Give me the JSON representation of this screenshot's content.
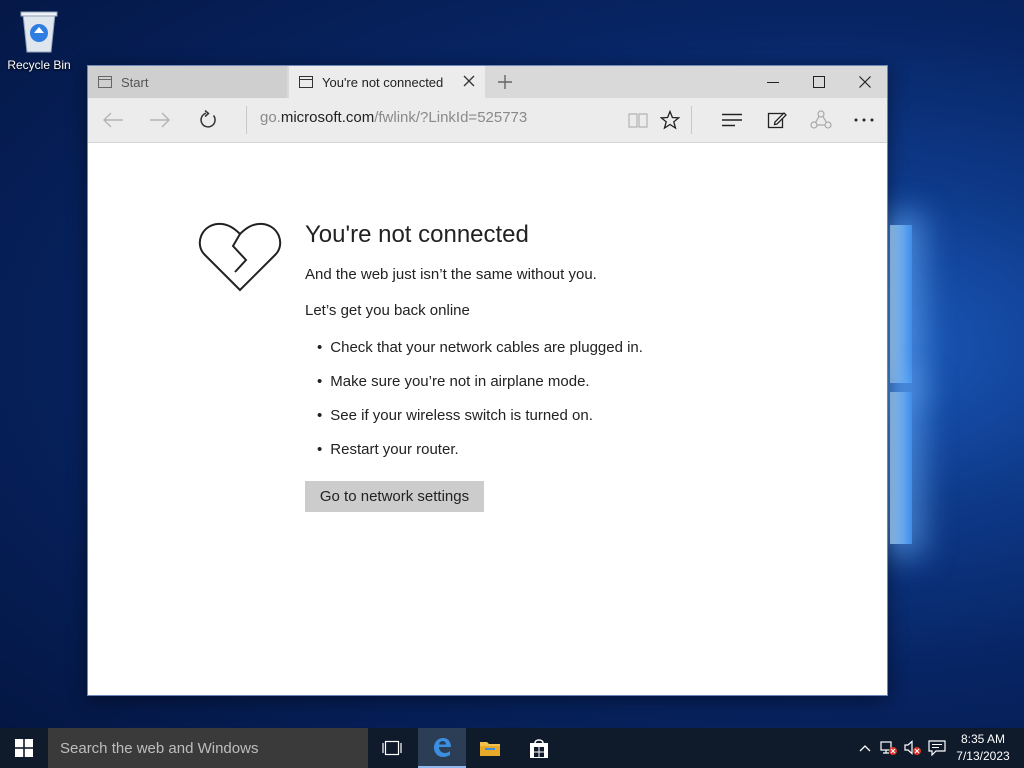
{
  "desktop": {
    "recycle_bin_label": "Recycle Bin"
  },
  "browser": {
    "tabs": [
      {
        "label": "Start",
        "active": false
      },
      {
        "label": "You're not connected",
        "active": true
      }
    ],
    "address": {
      "prefix": "go.",
      "domain": "microsoft.com",
      "path": "/fwlink/?LinkId=525773"
    }
  },
  "page": {
    "title": "You're not connected",
    "subtitle": "And the web just isn’t the same without you.",
    "prompt": "Let’s get you back online",
    "tips": [
      "Check that your network cables are plugged in.",
      "Make sure you’re not in airplane mode.",
      "See if your wireless switch is turned on.",
      "Restart your router."
    ],
    "network_button": "Go to network settings"
  },
  "taskbar": {
    "search_placeholder": "Search the web and Windows",
    "time": "8:35 AM",
    "date": "7/13/2023"
  },
  "colors": {
    "taskbar": "#0f1a2b",
    "tab_active": "#ececec",
    "button_gray": "#cccccc"
  }
}
